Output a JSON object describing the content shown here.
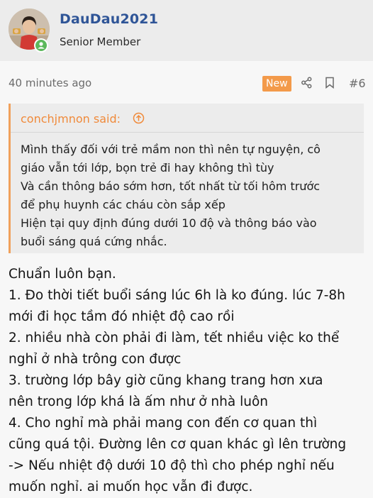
{
  "user": {
    "name": "DauDau2021",
    "title": "Senior Member"
  },
  "post": {
    "time": "40 minutes ago",
    "badge": "New",
    "number": "#6"
  },
  "quote": {
    "author": "conchjmnon said:",
    "lines": [
      "Mình thấy đối với trẻ mầm non thì nên tự nguyện, cô",
      "giáo vẫn tới lớp, bọn trẻ đi hay không thì tùy",
      "Và cần thông báo sớm hơn, tốt nhất từ tối hôm trước",
      "để phụ huynh các cháu còn sắp xếp",
      "Hiện tại quy định đúng dưới 10 độ và thông báo vào",
      "buổi sáng quá cứng nhắc."
    ]
  },
  "message": {
    "lines": [
      "Chuẩn luôn bạn.",
      "1. Đo thời tiết buổi sáng lúc 6h là ko đúng. lúc 7-8h",
      "mới đi học tầm đó nhiệt độ cao rồi",
      "2. nhiều nhà còn phải đi làm, tết nhiều việc ko thể",
      "nghỉ ở nhà trông con được",
      "3. trường lớp bây giờ cũng khang trang hơn xưa",
      "nên trong lớp khá là ấm như ở nhà luôn",
      "4. Cho nghỉ mà phải mang con đến cơ quan thì",
      "cũng quá tội. Đường lên cơ quan khác gì lên trường",
      "-> Nếu nhiệt độ dưới 10 độ thì cho phép nghỉ nếu",
      "muốn nghỉ. ai muốn học vẫn đi được."
    ]
  },
  "colors": {
    "username": "#2f5597",
    "badge": "#f39a4a",
    "quote_author": "#f08a3a",
    "online": "#5cb85c"
  },
  "icons": [
    "online-status-icon",
    "share-icon",
    "bookmark-icon",
    "jump-to-quote-icon"
  ]
}
